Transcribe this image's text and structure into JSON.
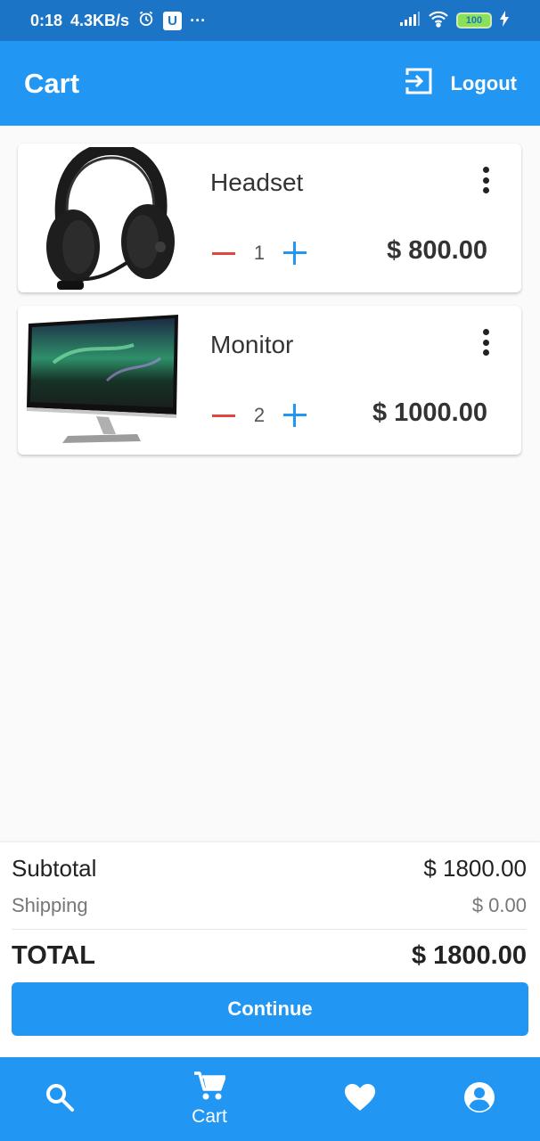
{
  "status_bar": {
    "time": "0:18",
    "speed": "4.3KB/s",
    "u_badge": "U",
    "more": "···",
    "battery": "100"
  },
  "app_bar": {
    "title": "Cart",
    "logout_label": "Logout"
  },
  "items": [
    {
      "name": "Headset",
      "quantity": "1",
      "price": "$ 800.00",
      "image_icon": "headset-image"
    },
    {
      "name": "Monitor",
      "quantity": "2",
      "price": "$ 1000.00",
      "image_icon": "monitor-image"
    }
  ],
  "summary": {
    "subtotal_label": "Subtotal",
    "subtotal_value": "$ 1800.00",
    "shipping_label": "Shipping",
    "shipping_value": "$ 0.00",
    "total_label": "TOTAL",
    "total_value": "$ 1800.00",
    "continue_label": "Continue"
  },
  "bottom_nav": {
    "cart_label": "Cart"
  },
  "colors": {
    "primary": "#2196f3",
    "status_bar": "#1c74c6",
    "minus": "#e1463c",
    "background": "#fafafa"
  }
}
